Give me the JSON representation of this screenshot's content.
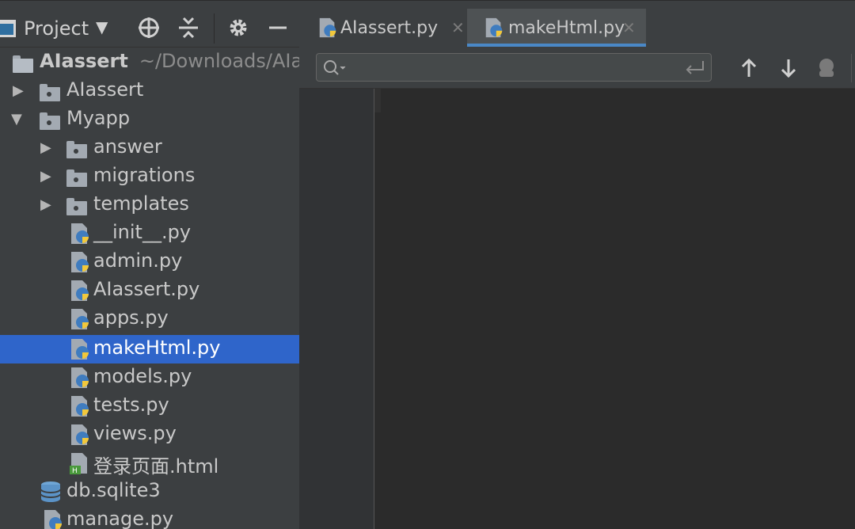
{
  "project_panel": {
    "title": "Project",
    "buttons": [
      "locate-icon",
      "collapse-icon",
      "gear-icon",
      "minimize-icon"
    ]
  },
  "tree": {
    "root": {
      "label": "AIassert",
      "path": "~/Downloads/AIassert"
    },
    "items": [
      {
        "label": "AIassert",
        "type": "folder",
        "level": 1,
        "expanded": false
      },
      {
        "label": "Myapp",
        "type": "folder",
        "level": 1,
        "expanded": true
      },
      {
        "label": "answer",
        "type": "folder",
        "level": 2,
        "expanded": false
      },
      {
        "label": "migrations",
        "type": "folder",
        "level": 2,
        "expanded": false
      },
      {
        "label": "templates",
        "type": "folder",
        "level": 2,
        "expanded": false
      },
      {
        "label": "__init__.py",
        "type": "python",
        "level": 2
      },
      {
        "label": "admin.py",
        "type": "python",
        "level": 2
      },
      {
        "label": "AIassert.py",
        "type": "python",
        "level": 2
      },
      {
        "label": "apps.py",
        "type": "python",
        "level": 2
      },
      {
        "label": "makeHtml.py",
        "type": "python",
        "level": 2,
        "selected": true
      },
      {
        "label": "models.py",
        "type": "python",
        "level": 2
      },
      {
        "label": "tests.py",
        "type": "python",
        "level": 2
      },
      {
        "label": "views.py",
        "type": "python",
        "level": 2
      },
      {
        "label": "登录页面.html",
        "type": "html",
        "level": 2
      },
      {
        "label": "db.sqlite3",
        "type": "database",
        "level": 1
      },
      {
        "label": "manage.py",
        "type": "python",
        "level": 1
      }
    ]
  },
  "editor_tabs": [
    {
      "label": "AIassert.py",
      "active": false
    },
    {
      "label": "makeHtml.py",
      "active": true
    }
  ],
  "search": {
    "value": "",
    "placeholder": ""
  },
  "colors": {
    "selection": "#2f65ca",
    "active_tab_underline": "#4a88c7",
    "python_blue": "#3f7cbf",
    "python_yellow": "#f2c83b"
  }
}
